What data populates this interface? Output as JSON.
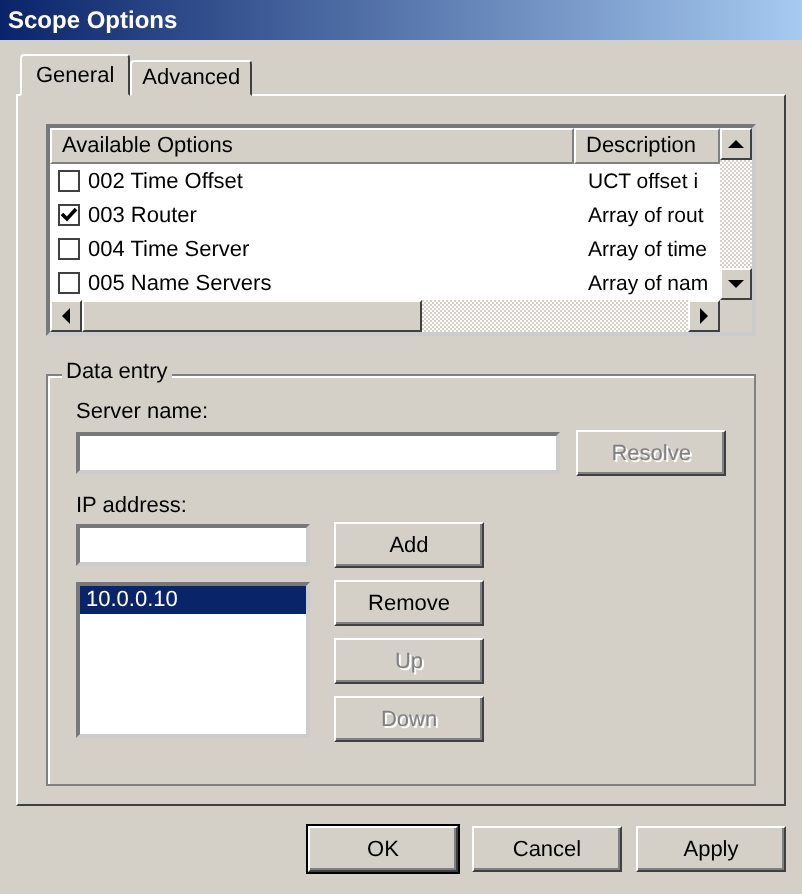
{
  "window": {
    "title": "Scope Options"
  },
  "tabs": [
    {
      "label": "General",
      "selected": true
    },
    {
      "label": "Advanced",
      "selected": false
    }
  ],
  "options_list": {
    "columns": [
      "Available Options",
      "Description"
    ],
    "rows": [
      {
        "name": "002 Time Offset",
        "description": "UCT offset i",
        "checked": false
      },
      {
        "name": "003 Router",
        "description": "Array of rout",
        "checked": true
      },
      {
        "name": "004 Time Server",
        "description": "Array of time",
        "checked": false
      },
      {
        "name": "005 Name Servers",
        "description": "Array of nam",
        "checked": false
      }
    ]
  },
  "data_entry": {
    "title": "Data entry",
    "server_name_label": "Server name:",
    "resolve_button": {
      "label": "Resolve",
      "disabled": true
    },
    "ip_address_label": "IP address:",
    "ip_list": [
      {
        "label": "10.0.0.10",
        "selected": true
      }
    ],
    "buttons": [
      {
        "label": "Add",
        "disabled": false
      },
      {
        "label": "Remove",
        "disabled": false
      },
      {
        "label": "Up",
        "disabled": true
      },
      {
        "label": "Down",
        "disabled": true
      }
    ]
  },
  "footer_buttons": [
    {
      "label": "OK",
      "default": true
    },
    {
      "label": "Cancel",
      "default": false
    },
    {
      "label": "Apply",
      "default": false
    }
  ]
}
